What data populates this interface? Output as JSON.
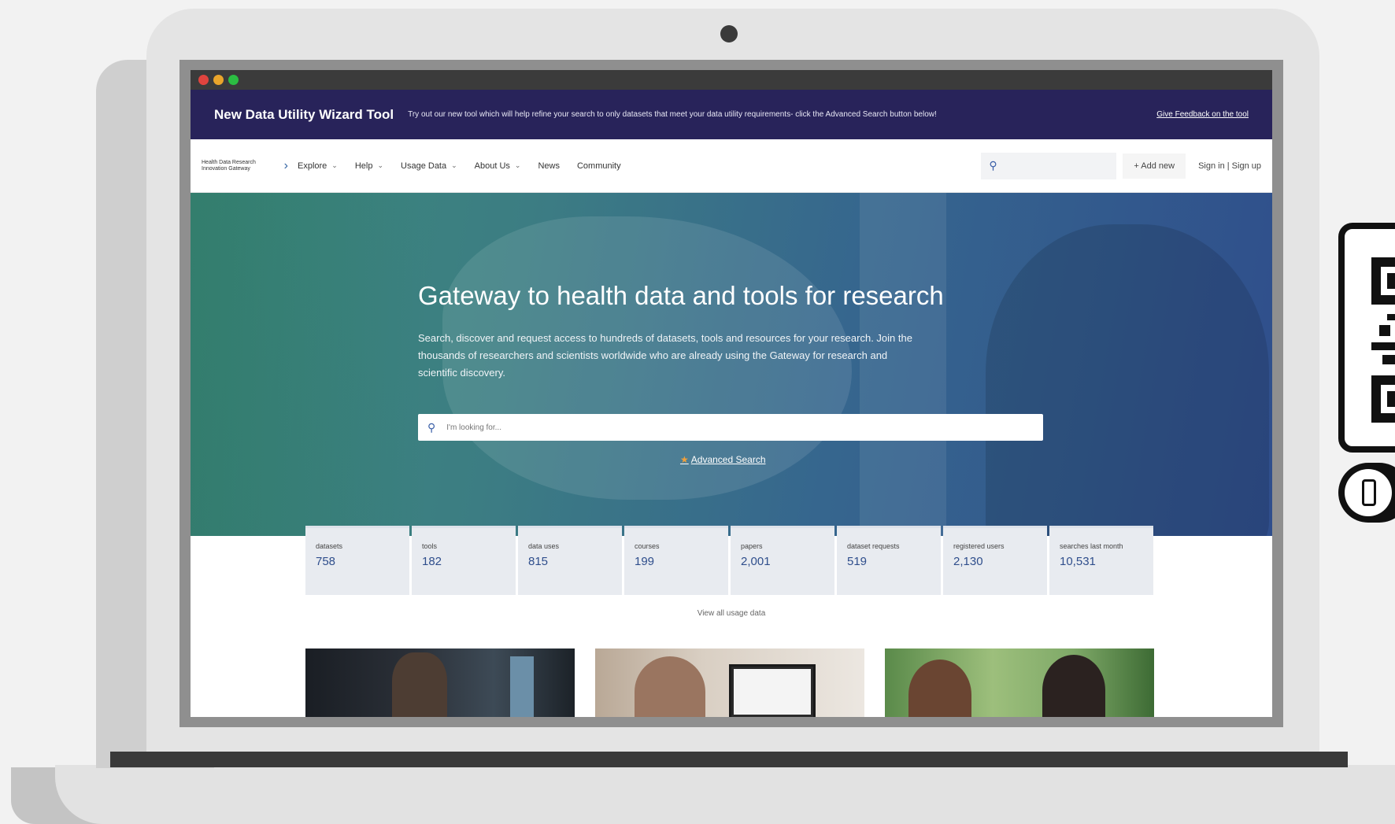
{
  "window": {
    "traffic_lights": [
      "#e0443e",
      "#e9a52b",
      "#2bbd42"
    ]
  },
  "promo": {
    "title": "New Data Utility Wizard Tool",
    "text": "Try out our new tool which will help refine your search to only datasets that meet your data utility requirements- click the Advanced Search button below!",
    "link": "Give Feedback on the tool"
  },
  "nav": {
    "logo_text": "Health Data Research Innovation Gateway",
    "items": [
      {
        "label": "Explore",
        "dropdown": true
      },
      {
        "label": "Help",
        "dropdown": true
      },
      {
        "label": "Usage Data",
        "dropdown": true
      },
      {
        "label": "About Us",
        "dropdown": true
      },
      {
        "label": "News",
        "dropdown": false
      },
      {
        "label": "Community",
        "dropdown": false
      }
    ],
    "add_new": "+ Add new",
    "sign_in": "Sign in | Sign up"
  },
  "hero": {
    "title": "Gateway to health data and tools for research",
    "description": "Search, discover and request access to hundreds of datasets, tools and resources for your research. Join the thousands of researchers and scientists worldwide who are already using the Gateway for research and scientific discovery.",
    "search_placeholder": "I'm looking for...",
    "advanced_search": "Advanced Search"
  },
  "stats": [
    {
      "label": "datasets",
      "value": "758"
    },
    {
      "label": "tools",
      "value": "182"
    },
    {
      "label": "data uses",
      "value": "815"
    },
    {
      "label": "courses",
      "value": "199"
    },
    {
      "label": "papers",
      "value": "2,001"
    },
    {
      "label": "dataset requests",
      "value": "519"
    },
    {
      "label": "registered users",
      "value": "2,130"
    },
    {
      "label": "searches last month",
      "value": "10,531"
    }
  ],
  "view_usage": "View all usage data",
  "colors": {
    "promo_bg": "#28235a",
    "accent": "#2f4e8c",
    "hero_start": "#3a8a7a",
    "hero_end": "#2f4e8c",
    "star": "#f2a13b"
  },
  "icons": {
    "nav_search": "search-icon",
    "hero_search": "search-icon",
    "advanced": "star-icon",
    "badge": "qr-code-icon",
    "phone": "phone-icon"
  }
}
